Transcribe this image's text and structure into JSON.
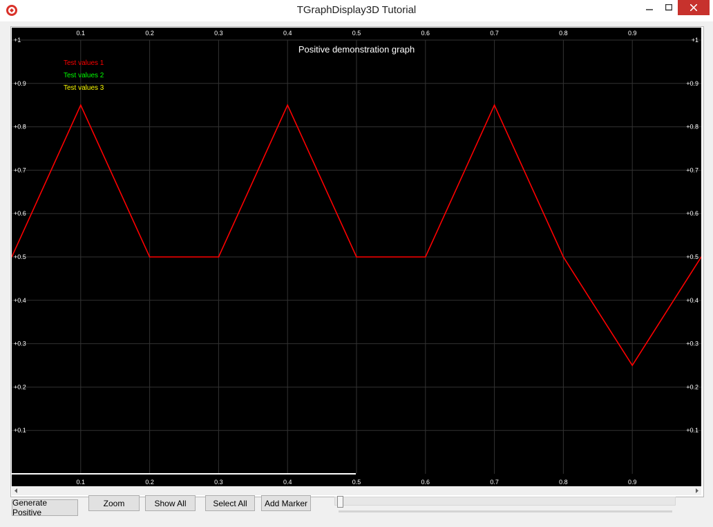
{
  "window": {
    "title": "TGraphDisplay3D Tutorial",
    "icon": "app-logo-icon"
  },
  "toolbar": {
    "generate_label": "Generate Positive",
    "zoom_label": "Zoom",
    "show_all_label": "Show All",
    "select_all_label": "Select All",
    "add_marker_label": "Add Marker"
  },
  "colors": {
    "graph_background": "#000000",
    "grid": "#333333",
    "series1": "#ff0000",
    "series2": "#00ff00",
    "series3": "#ffff00",
    "text": "#ffffff"
  },
  "chart_data": {
    "type": "line",
    "title": "Positive demonstration graph",
    "xlim": [
      0,
      1
    ],
    "ylim": [
      0,
      1
    ],
    "x_ticks": [
      "0.1",
      "0.2",
      "0.3",
      "0.4",
      "0.5",
      "0.6",
      "0.7",
      "0.8",
      "0.9"
    ],
    "y_ticks": [
      "+0.1",
      "+0.2",
      "+0.3",
      "+0.4",
      "+0.5",
      "+0.6",
      "+0.7",
      "+0.8",
      "+0.9",
      "+1"
    ],
    "grid": true,
    "legend_position": "top-left",
    "series": [
      {
        "name": "Test values 1",
        "color": "#ff0000",
        "x": [
          0.0,
          0.1,
          0.2,
          0.3,
          0.4,
          0.5,
          0.6,
          0.7,
          0.8,
          0.9,
          1.0
        ],
        "y": [
          0.5,
          0.85,
          0.5,
          0.5,
          0.85,
          0.5,
          0.5,
          0.85,
          0.5,
          0.25,
          0.5
        ]
      },
      {
        "name": "Test values 2",
        "color": "#00ff00",
        "x": [],
        "y": []
      },
      {
        "name": "Test values 3",
        "color": "#ffff00",
        "x": [],
        "y": []
      }
    ]
  }
}
